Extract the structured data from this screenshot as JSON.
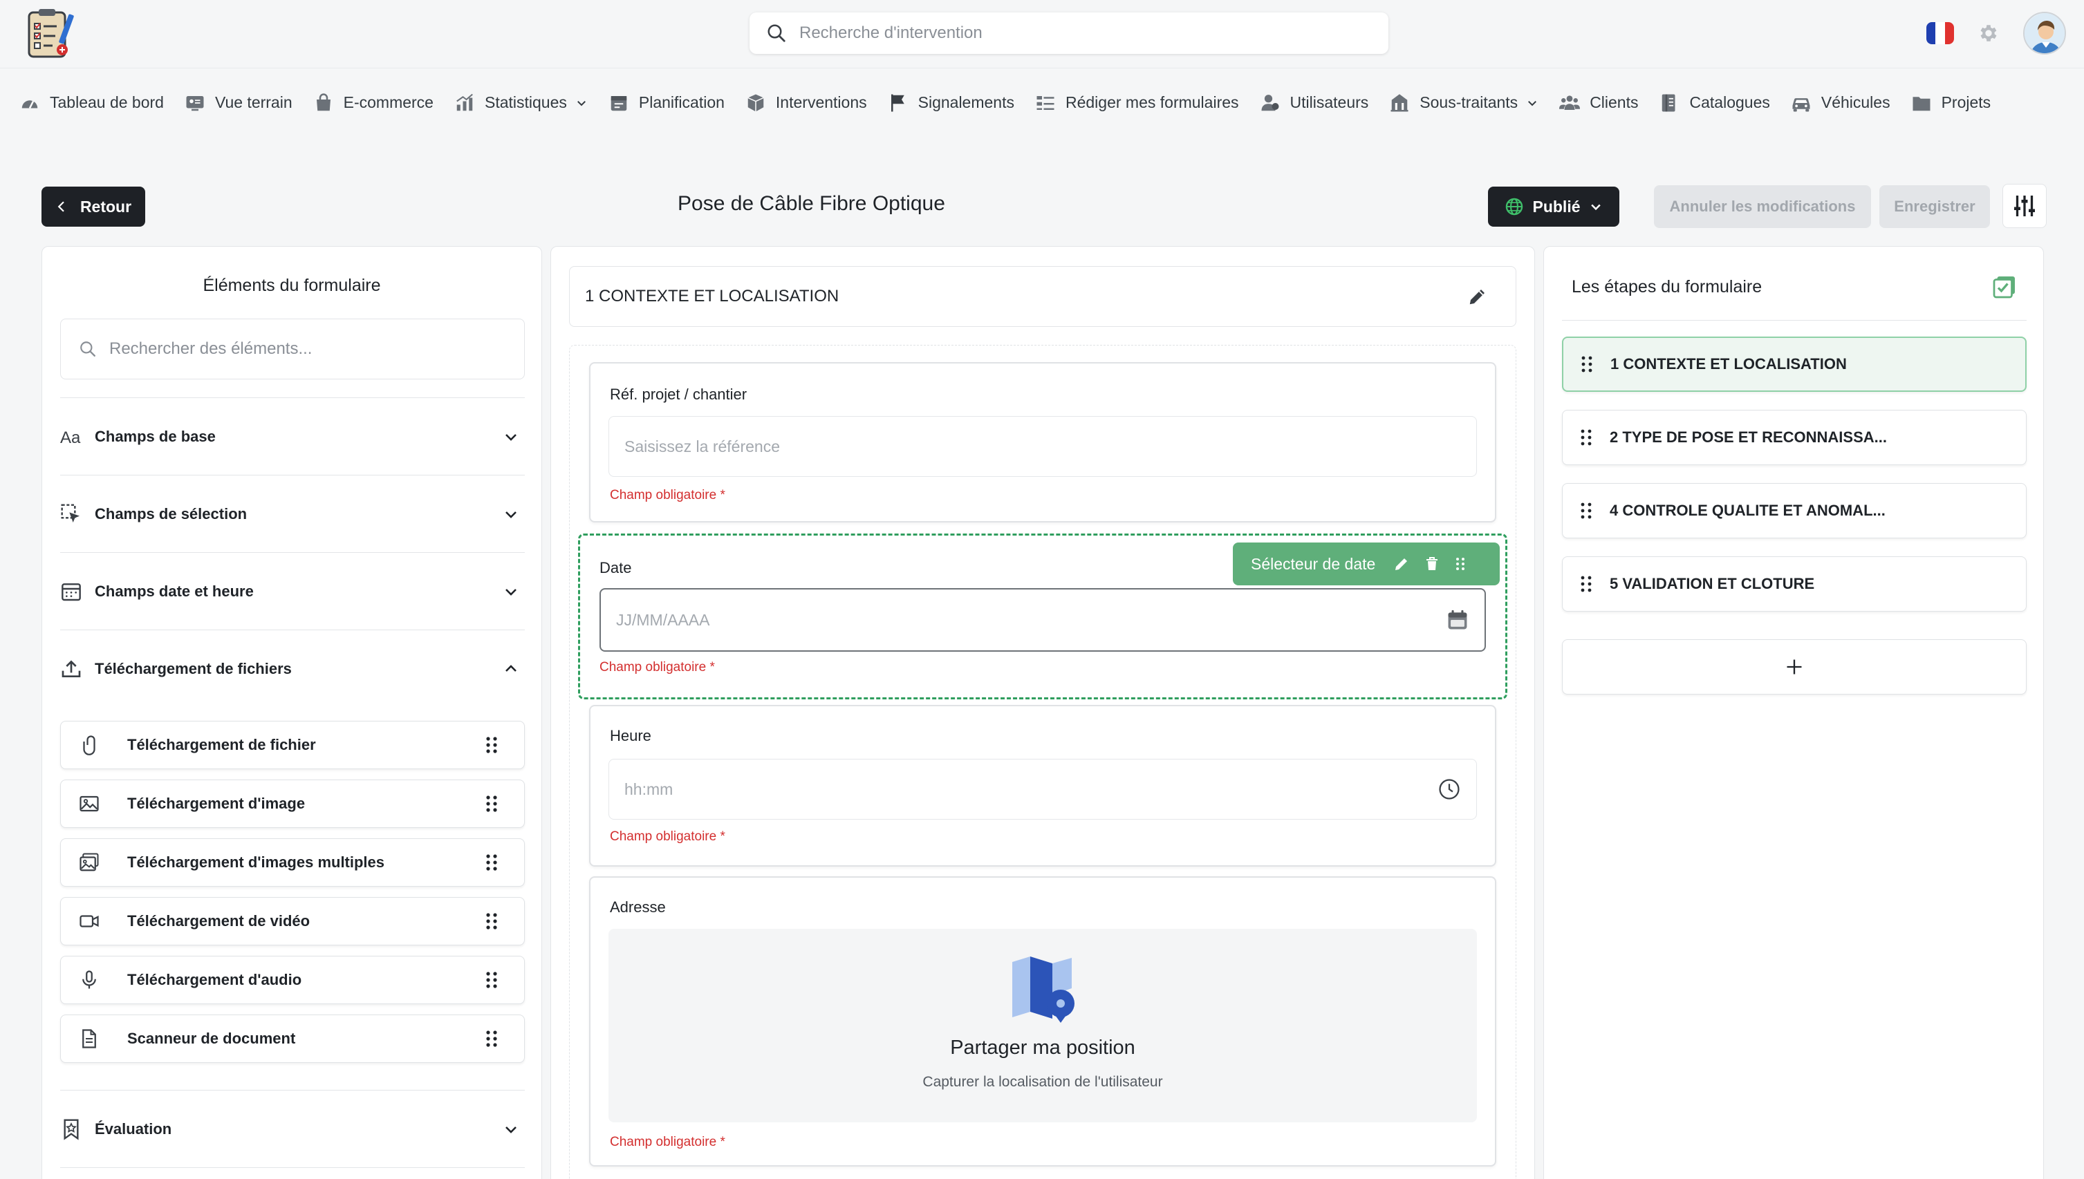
{
  "header": {
    "search_placeholder": "Recherche d'intervention",
    "language": "Français"
  },
  "nav": {
    "items": [
      {
        "label": "Tableau de bord",
        "icon": "dashboard-icon",
        "dropdown": false
      },
      {
        "label": "Vue terrain",
        "icon": "field-view-icon",
        "dropdown": false
      },
      {
        "label": "E-commerce",
        "icon": "shopping-bag-icon",
        "dropdown": false
      },
      {
        "label": "Statistiques",
        "icon": "stats-icon",
        "dropdown": true
      },
      {
        "label": "Planification",
        "icon": "calendar-icon",
        "dropdown": false
      },
      {
        "label": "Interventions",
        "icon": "box-icon",
        "dropdown": false
      },
      {
        "label": "Signalements",
        "icon": "flag-icon",
        "dropdown": false
      },
      {
        "label": "Rédiger mes formulaires",
        "icon": "form-icon",
        "dropdown": false
      },
      {
        "label": "Utilisateurs",
        "icon": "users-icon",
        "dropdown": false
      },
      {
        "label": "Sous-traitants",
        "icon": "building-icon",
        "dropdown": true
      },
      {
        "label": "Clients",
        "icon": "clients-icon",
        "dropdown": false
      },
      {
        "label": "Catalogues",
        "icon": "catalog-icon",
        "dropdown": false
      },
      {
        "label": "Véhicules",
        "icon": "car-icon",
        "dropdown": false
      },
      {
        "label": "Projets",
        "icon": "folder-icon",
        "dropdown": false
      }
    ]
  },
  "page": {
    "back_label": "Retour",
    "title": "Pose de Câble Fibre Optique",
    "status_label": "Publié",
    "cancel_label": "Annuler les modifications",
    "save_label": "Enregistrer"
  },
  "elements_panel": {
    "title": "Éléments du formulaire",
    "search_placeholder": "Rechercher des éléments...",
    "categories": [
      {
        "label": "Champs de base",
        "icon": "text-aa-icon",
        "expanded": false
      },
      {
        "label": "Champs de sélection",
        "icon": "cursor-select-icon",
        "expanded": false
      },
      {
        "label": "Champs date et heure",
        "icon": "calendar-grid-icon",
        "expanded": false
      },
      {
        "label": "Téléchargement de fichiers",
        "icon": "upload-icon",
        "expanded": true
      },
      {
        "label": "Évaluation",
        "icon": "bookmark-star-icon",
        "expanded": false
      }
    ],
    "file_items": [
      {
        "label": "Téléchargement de fichier",
        "icon": "paperclip-icon"
      },
      {
        "label": "Téléchargement d'image",
        "icon": "image-icon"
      },
      {
        "label": "Téléchargement d'images multiples",
        "icon": "images-icon"
      },
      {
        "label": "Téléchargement de vidéo",
        "icon": "video-icon"
      },
      {
        "label": "Téléchargement d'audio",
        "icon": "microphone-icon"
      },
      {
        "label": "Scanneur de document",
        "icon": "document-icon"
      }
    ]
  },
  "form": {
    "step_title": "1 CONTEXTE ET LOCALISATION",
    "fields": [
      {
        "label": "Réf. projet / chantier",
        "placeholder": "Saisissez la référence",
        "required_text": "Champ obligatoire *"
      },
      {
        "label": "Date",
        "placeholder": "JJ/MM/AAAA",
        "required_text": "Champ obligatoire *",
        "toolbar_label": "Sélecteur de date"
      },
      {
        "label": "Heure",
        "placeholder": "hh:mm",
        "required_text": "Champ obligatoire *"
      },
      {
        "label": "Adresse",
        "share_title": "Partager ma position",
        "share_subtitle": "Capturer la localisation de l'utilisateur",
        "required_text": "Champ obligatoire *"
      }
    ]
  },
  "steps_panel": {
    "title": "Les étapes du formulaire",
    "steps": [
      {
        "label": "1 CONTEXTE ET LOCALISATION",
        "active": true
      },
      {
        "label": "2 TYPE DE POSE ET RECONNAISSA...",
        "active": false
      },
      {
        "label": "4 CONTROLE QUALITE ET ANOMAL...",
        "active": false
      },
      {
        "label": "5 VALIDATION ET CLOTURE",
        "active": false
      }
    ]
  },
  "colors": {
    "accent_green": "#5faf7a",
    "selected_border": "#2f9e5e",
    "dark_button": "#1e2126",
    "required_red": "#d32f2f"
  }
}
